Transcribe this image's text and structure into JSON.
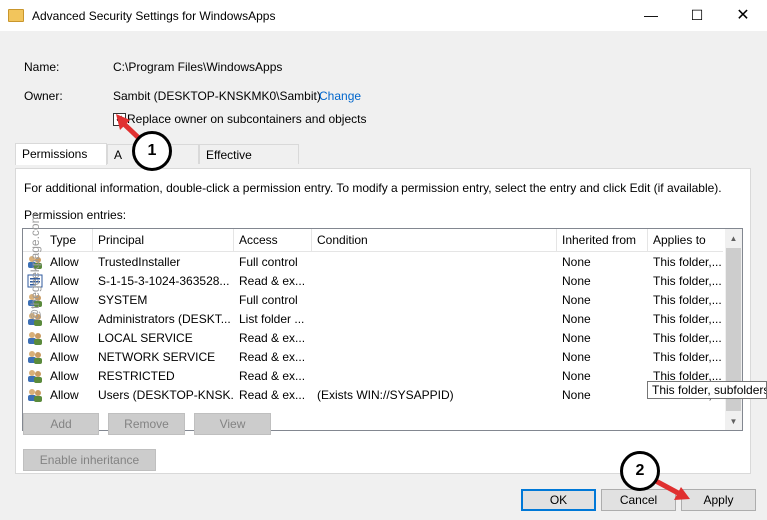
{
  "window": {
    "title": "Advanced Security Settings for WindowsApps",
    "controls": {
      "minimize": "—",
      "maximize": "☐",
      "close": "✕"
    }
  },
  "info": {
    "name_label": "Name:",
    "name_value": "C:\\Program Files\\WindowsApps",
    "owner_label": "Owner:",
    "owner_value": "Sambit (DESKTOP-KNSKMK0\\Sambit)",
    "change_link": "Change",
    "replace_owner_label": "Replace owner on subcontainers and objects",
    "replace_owner_checked": true,
    "check_glyph": "✓"
  },
  "tabs": [
    {
      "label": "Permissions",
      "active": true
    },
    {
      "label": "Auditing",
      "visible_text": "A      g",
      "active": false
    },
    {
      "label": "Effective Access",
      "active": false
    }
  ],
  "panel": {
    "info_text": "For additional information, double-click a permission entry. To modify a permission entry, select the entry and click Edit (if available).",
    "entries_label": "Permission entries:"
  },
  "table": {
    "columns": [
      "Type",
      "Principal",
      "Access",
      "Condition",
      "Inherited from",
      "Applies to"
    ],
    "rows": [
      {
        "icon": "users-icon",
        "type": "Allow",
        "principal": "TrustedInstaller",
        "access": "Full control",
        "condition": "",
        "inherited": "None",
        "applies": "This folder,..."
      },
      {
        "icon": "package-sid-icon",
        "type": "Allow",
        "principal": "S-1-15-3-1024-363528...",
        "access": "Read & ex...",
        "condition": "",
        "inherited": "None",
        "applies": "This folder,..."
      },
      {
        "icon": "users-icon",
        "type": "Allow",
        "principal": "SYSTEM",
        "access": "Full control",
        "condition": "",
        "inherited": "None",
        "applies": "This folder,..."
      },
      {
        "icon": "users-icon",
        "type": "Allow",
        "principal": "Administrators (DESKT...",
        "access": "List folder ...",
        "condition": "",
        "inherited": "None",
        "applies": "This folder,..."
      },
      {
        "icon": "users-icon",
        "type": "Allow",
        "principal": "LOCAL SERVICE",
        "access": "Read & ex...",
        "condition": "",
        "inherited": "None",
        "applies": "This folder,..."
      },
      {
        "icon": "users-icon",
        "type": "Allow",
        "principal": "NETWORK SERVICE",
        "access": "Read & ex...",
        "condition": "",
        "inherited": "None",
        "applies": "This folder,..."
      },
      {
        "icon": "users-icon",
        "type": "Allow",
        "principal": "RESTRICTED",
        "access": "Read & ex...",
        "condition": "",
        "inherited": "None",
        "applies": "This folder,..."
      },
      {
        "icon": "users-icon",
        "type": "Allow",
        "principal": "Users (DESKTOP-KNSK...",
        "access": "Read & ex...",
        "condition": "(Exists WIN://SYSAPPID)",
        "inherited": "None",
        "applies": "This folder,..."
      }
    ],
    "tooltip": "This folder, subfolders"
  },
  "buttons": {
    "add": "Add",
    "remove": "Remove",
    "view": "View",
    "enable_inheritance": "Enable inheritance",
    "ok": "OK",
    "cancel": "Cancel",
    "apply": "Apply"
  },
  "annotations": {
    "badge1": "1",
    "badge2": "2",
    "watermark": "@thegeekpage.com"
  },
  "colors": {
    "link": "#0066cc",
    "accent": "#0078d7",
    "arrow": "#e03030"
  }
}
